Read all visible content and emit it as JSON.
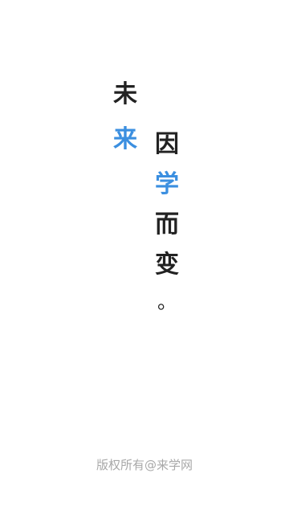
{
  "slogan": {
    "col1": [
      "未",
      "来"
    ],
    "col2": [
      "因",
      "学",
      "而",
      "变",
      "。"
    ]
  },
  "colors": {
    "text": "#222222",
    "accent": "#3b8fe0",
    "footer": "#a8a8a8",
    "background": "#ffffff"
  },
  "footer": {
    "copyright": "版权所有@来学网"
  }
}
